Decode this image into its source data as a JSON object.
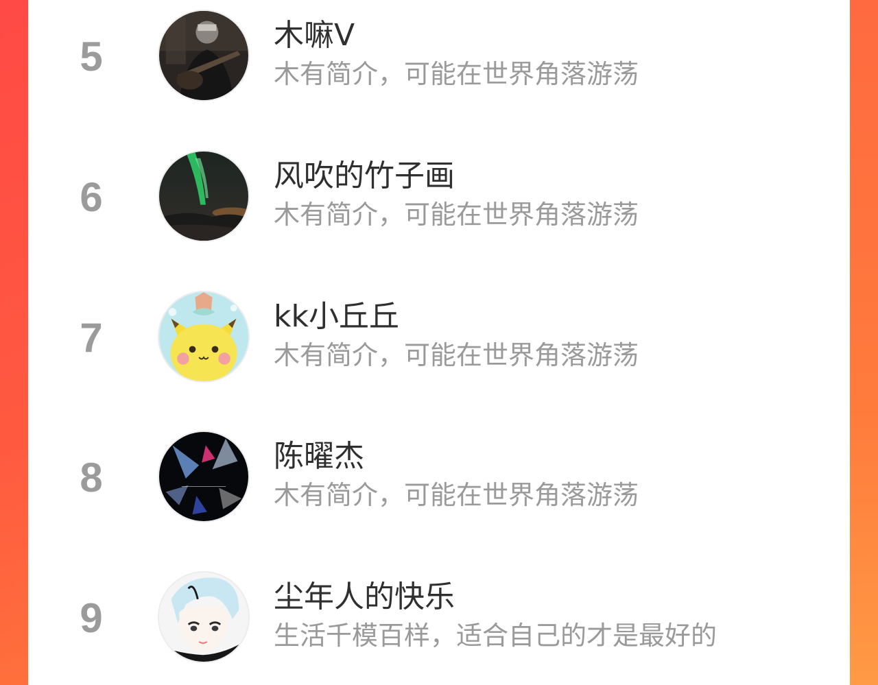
{
  "rank_list": {
    "items": [
      {
        "rank": "5",
        "name": "木嘛V",
        "bio": "木有简介，可能在世界角落游荡",
        "avatar_icon": "guitarist-photo-avatar"
      },
      {
        "rank": "6",
        "name": "风吹的竹子画",
        "bio": "木有简介，可能在世界角落游荡",
        "avatar_icon": "aurora-landscape-avatar"
      },
      {
        "rank": "7",
        "name": "kk小丘丘",
        "bio": "木有简介，可能在世界角落游荡",
        "avatar_icon": "pikachu-cartoon-avatar"
      },
      {
        "rank": "8",
        "name": "陈曜杰",
        "bio": "木有简介，可能在世界角落游荡",
        "avatar_icon": "abstract-dark-hazard-avatar"
      },
      {
        "rank": "9",
        "name": "尘年人的快乐",
        "bio": "生活千模百样，适合自己的才是最好的",
        "avatar_icon": "anime-boy-avatar"
      }
    ]
  },
  "colors": {
    "background_left": "#ff4a45",
    "background_right": "#ff9a40",
    "rank_number": "#9b9b9b",
    "name_text": "#2f2f2f",
    "bio_text": "#9a9a9a"
  }
}
